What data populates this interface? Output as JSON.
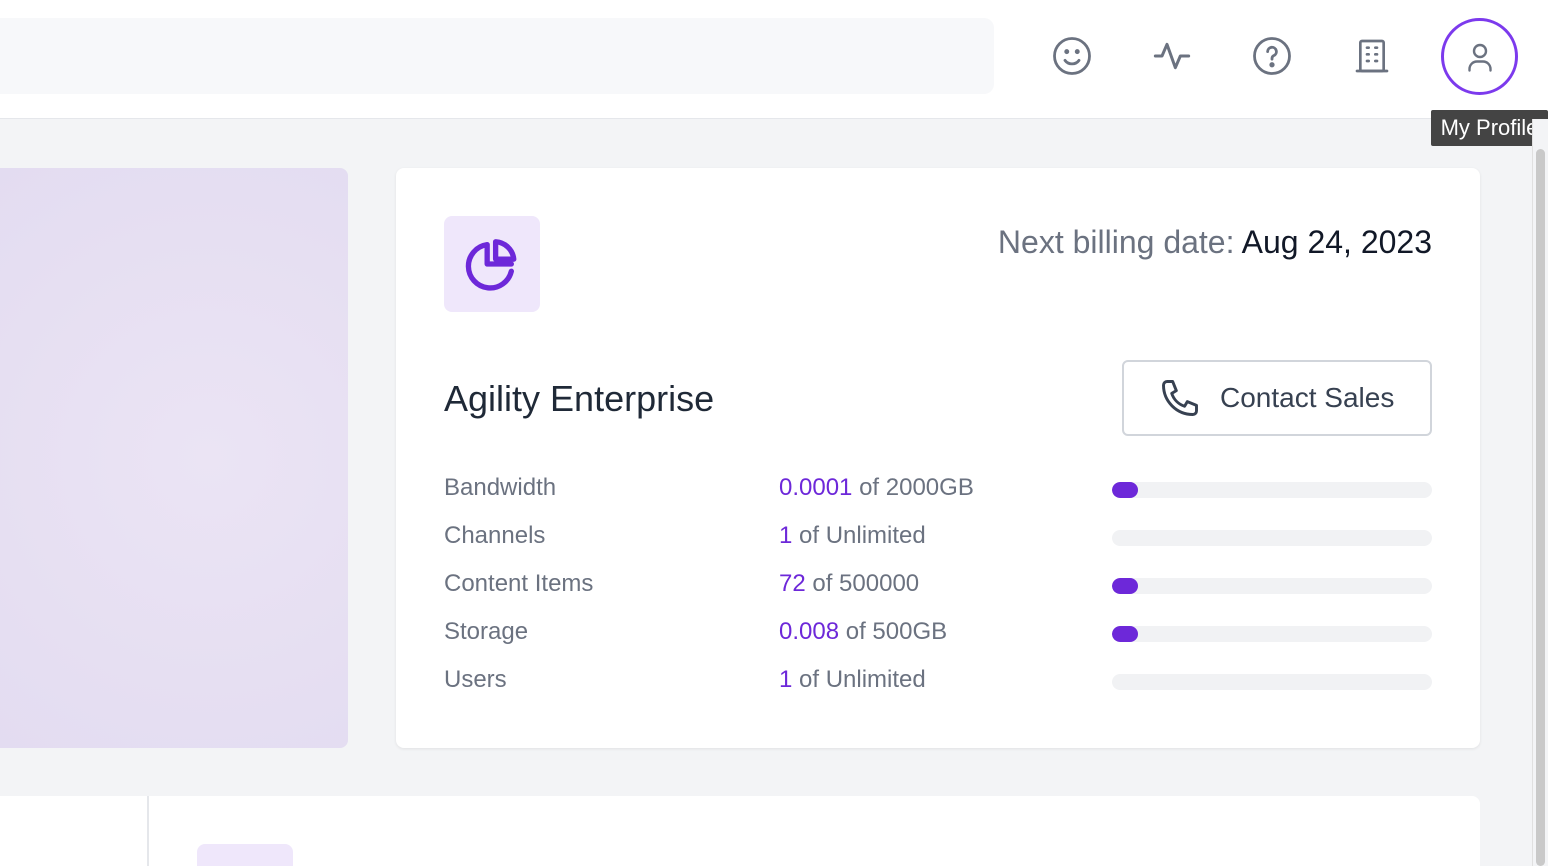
{
  "header": {
    "search_placeholder": "",
    "icons": [
      "smiley-icon",
      "activity-icon",
      "help-icon",
      "building-icon"
    ],
    "profile_tooltip": "My Profile"
  },
  "plan": {
    "billing_label": "Next billing date:",
    "billing_date": "Aug 24, 2023",
    "name": "Agility Enterprise",
    "contact_label": "Contact Sales",
    "usage": [
      {
        "label": "Bandwidth",
        "used": "0.0001",
        "total": "of 2000GB",
        "fill": 0.08
      },
      {
        "label": "Channels",
        "used": "1",
        "total": "of Unlimited",
        "fill": 0
      },
      {
        "label": "Content Items",
        "used": "72",
        "total": "of 500000",
        "fill": 0.08
      },
      {
        "label": "Storage",
        "used": "0.008",
        "total": "of 500GB",
        "fill": 0.08
      },
      {
        "label": "Users",
        "used": "1",
        "total": "of Unlimited",
        "fill": 0
      }
    ]
  },
  "colors": {
    "accent": "#6d28d9",
    "accent_light": "#efe7fb",
    "text_muted": "#6b7280"
  }
}
